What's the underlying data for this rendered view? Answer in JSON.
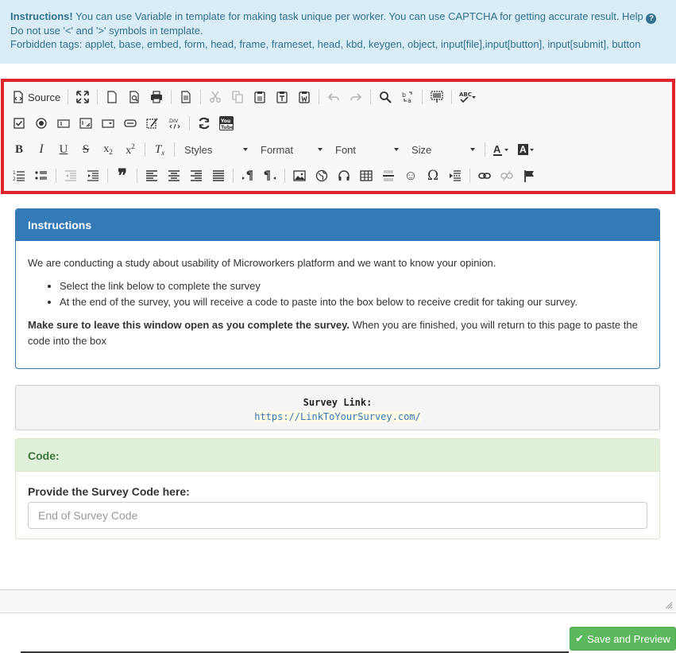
{
  "info": {
    "title": "Instructions!",
    "line1": " You can use Variable in template for making task unique per worker. You can use CAPTCHA for getting accurate result. Help ",
    "help_icon": "question-circle-icon",
    "line2": "Do not use '<' and '>' symbols in template.",
    "line3": "Forbidden tags: applet, base, embed, form, head, frame, frameset, head, kbd, keygen, object, input[file],input[button], input[submit], button"
  },
  "toolbar": {
    "source_label": "Source",
    "styles_label": "Styles",
    "format_label": "Format",
    "font_label": "Font",
    "size_label": "Size",
    "bold": "B",
    "italic": "I",
    "underline": "U",
    "strike": "S",
    "subscript": "x",
    "subscript_mark": "2",
    "superscript": "x",
    "superscript_mark": "2",
    "clear_format": "T",
    "blockquote": "❞",
    "omega": "Ω",
    "smiley": "☺",
    "div": "DIV",
    "youtube": "You Tube",
    "spell": "ABC"
  },
  "instructions": {
    "heading": "Instructions",
    "intro": "We are conducting a study about usability of Microworkers platform and we want to know your opinion.",
    "bullets": [
      "Select the link below to complete the survey",
      "At the end of the survey, you will receive a code to paste into the box below to receive credit for taking our survey."
    ],
    "note_bold": "Make sure to leave this window open as you complete the survey.",
    "note_rest": " When you are finished, you will return to this page to paste the code into the box"
  },
  "survey": {
    "label": "Survey Link:",
    "url": "https://LinkToYourSurvey.com/"
  },
  "code": {
    "heading": "Code:",
    "label": "Provide the Survey Code here:",
    "placeholder": "End of Survey Code"
  },
  "footer": {
    "save_label": "Save and Preview"
  },
  "colors": {
    "info_bg": "#d9edf7",
    "toolbar_border": "#e0242b",
    "panel_primary": "#337ab7",
    "success_bg": "#dff0d8",
    "button_green": "#5cb85c"
  }
}
